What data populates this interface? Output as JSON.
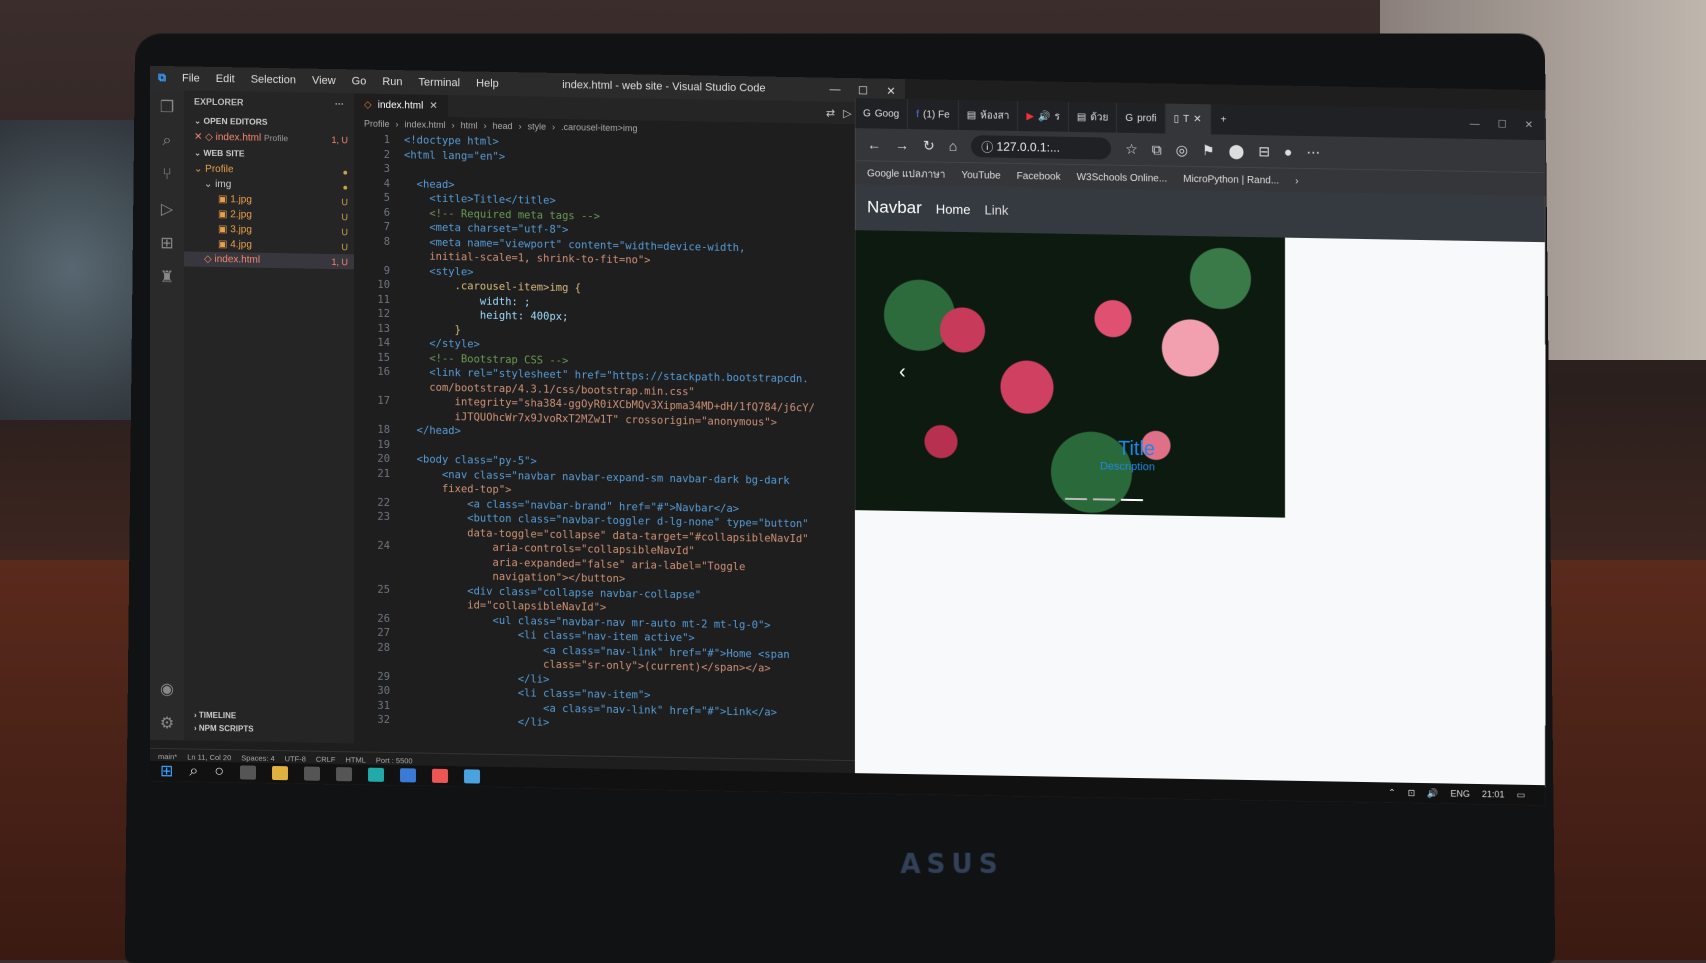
{
  "vscode": {
    "window_title": "index.html - web site - Visual Studio Code",
    "menu": [
      "File",
      "Edit",
      "Selection",
      "View",
      "Go",
      "Run",
      "Terminal",
      "Help"
    ],
    "explorer_label": "EXPLORER",
    "open_editors_label": "OPEN EDITORS",
    "open_editor_item": {
      "name": "index.html",
      "folder": "Profile",
      "status": "1, U"
    },
    "workspace_label": "WEB SITE",
    "tree": [
      {
        "name": "Profile",
        "status": "●"
      },
      {
        "name": "img",
        "status": "●"
      },
      {
        "name": "1.jpg",
        "status": "U"
      },
      {
        "name": "2.jpg",
        "status": "U"
      },
      {
        "name": "3.jpg",
        "status": "U"
      },
      {
        "name": "4.jpg",
        "status": "U"
      },
      {
        "name": "index.html",
        "status": "1, U"
      }
    ],
    "timeline_label": "TIMELINE",
    "npm_label": "NPM SCRIPTS",
    "tab_label": "index.html",
    "breadcrumbs": [
      "Profile",
      "index.html",
      "html",
      "head",
      "style",
      ".carousel-item>img"
    ],
    "status_bar": {
      "branch": "main*",
      "cursor": "Ln 11, Col 20",
      "spaces": "Spaces: 4",
      "encoding": "UTF-8",
      "eol": "CRLF",
      "lang": "HTML",
      "port": "Port : 5500"
    },
    "code_lines": [
      {
        "n": "1",
        "t": "<!doctype html>"
      },
      {
        "n": "2",
        "t": "<html lang=\"en\">"
      },
      {
        "n": "3",
        "t": ""
      },
      {
        "n": "4",
        "t": "  <head>"
      },
      {
        "n": "5",
        "t": "    <title>Title</title>"
      },
      {
        "n": "6",
        "t": "    <!-- Required meta tags -->"
      },
      {
        "n": "7",
        "t": "    <meta charset=\"utf-8\">"
      },
      {
        "n": "8",
        "t": "    <meta name=\"viewport\" content=\"width=device-width,"
      },
      {
        "n": "",
        "t": "    initial-scale=1, shrink-to-fit=no\">"
      },
      {
        "n": "9",
        "t": "    <style>"
      },
      {
        "n": "10",
        "t": "        .carousel-item>img {"
      },
      {
        "n": "11",
        "t": "            width: ;"
      },
      {
        "n": "12",
        "t": "            height: 400px;"
      },
      {
        "n": "13",
        "t": "        }"
      },
      {
        "n": "14",
        "t": "    </style>"
      },
      {
        "n": "15",
        "t": "    <!-- Bootstrap CSS -->"
      },
      {
        "n": "16",
        "t": "    <link rel=\"stylesheet\" href=\"https://stackpath.bootstrapcdn."
      },
      {
        "n": "",
        "t": "    com/bootstrap/4.3.1/css/bootstrap.min.css\""
      },
      {
        "n": "17",
        "t": "        integrity=\"sha384-ggOyR0iXCbMQv3Xipma34MD+dH/1fQ784/j6cY/"
      },
      {
        "n": "",
        "t": "        iJTQUOhcWr7x9JvoRxT2MZw1T\" crossorigin=\"anonymous\">"
      },
      {
        "n": "18",
        "t": "  </head>"
      },
      {
        "n": "19",
        "t": ""
      },
      {
        "n": "20",
        "t": "  <body class=\"py-5\">"
      },
      {
        "n": "21",
        "t": "      <nav class=\"navbar navbar-expand-sm navbar-dark bg-dark"
      },
      {
        "n": "",
        "t": "      fixed-top\">"
      },
      {
        "n": "22",
        "t": "          <a class=\"navbar-brand\" href=\"#\">Navbar</a>"
      },
      {
        "n": "23",
        "t": "          <button class=\"navbar-toggler d-lg-none\" type=\"button\""
      },
      {
        "n": "",
        "t": "          data-toggle=\"collapse\" data-target=\"#collapsibleNavId\""
      },
      {
        "n": "24",
        "t": "              aria-controls=\"collapsibleNavId\""
      },
      {
        "n": "",
        "t": "              aria-expanded=\"false\" aria-label=\"Toggle"
      },
      {
        "n": "",
        "t": "              navigation\"></button>"
      },
      {
        "n": "25",
        "t": "          <div class=\"collapse navbar-collapse\""
      },
      {
        "n": "",
        "t": "          id=\"collapsibleNavId\">"
      },
      {
        "n": "26",
        "t": "              <ul class=\"navbar-nav mr-auto mt-2 mt-lg-0\">"
      },
      {
        "n": "27",
        "t": "                  <li class=\"nav-item active\">"
      },
      {
        "n": "28",
        "t": "                      <a class=\"nav-link\" href=\"#\">Home <span"
      },
      {
        "n": "",
        "t": "                      class=\"sr-only\">(current)</span></a>"
      },
      {
        "n": "29",
        "t": "                  </li>"
      },
      {
        "n": "30",
        "t": "                  <li class=\"nav-item\">"
      },
      {
        "n": "31",
        "t": "                      <a class=\"nav-link\" href=\"#\">Link</a>"
      },
      {
        "n": "32",
        "t": "                  </li>"
      }
    ]
  },
  "browser": {
    "tabs": [
      {
        "label": "Goog"
      },
      {
        "label": "(1) Fe"
      },
      {
        "label": "ห้องสา"
      },
      {
        "label": "ร"
      },
      {
        "label": "ด้วย"
      },
      {
        "label": "profi"
      },
      {
        "label": "T"
      }
    ],
    "url": "127.0.0.1:...",
    "bookmarks": [
      "Google แปลภาษา",
      "YouTube",
      "Facebook",
      "W3Schools Online...",
      "MicroPython | Rand..."
    ],
    "page": {
      "brand": "Navbar",
      "links": [
        "Home",
        "Link"
      ],
      "carousel_title": "Title",
      "carousel_desc": "Description"
    }
  },
  "taskbar": {
    "lang": "ENG",
    "time": "21:01"
  },
  "hardware": {
    "brand": "ASUS"
  }
}
